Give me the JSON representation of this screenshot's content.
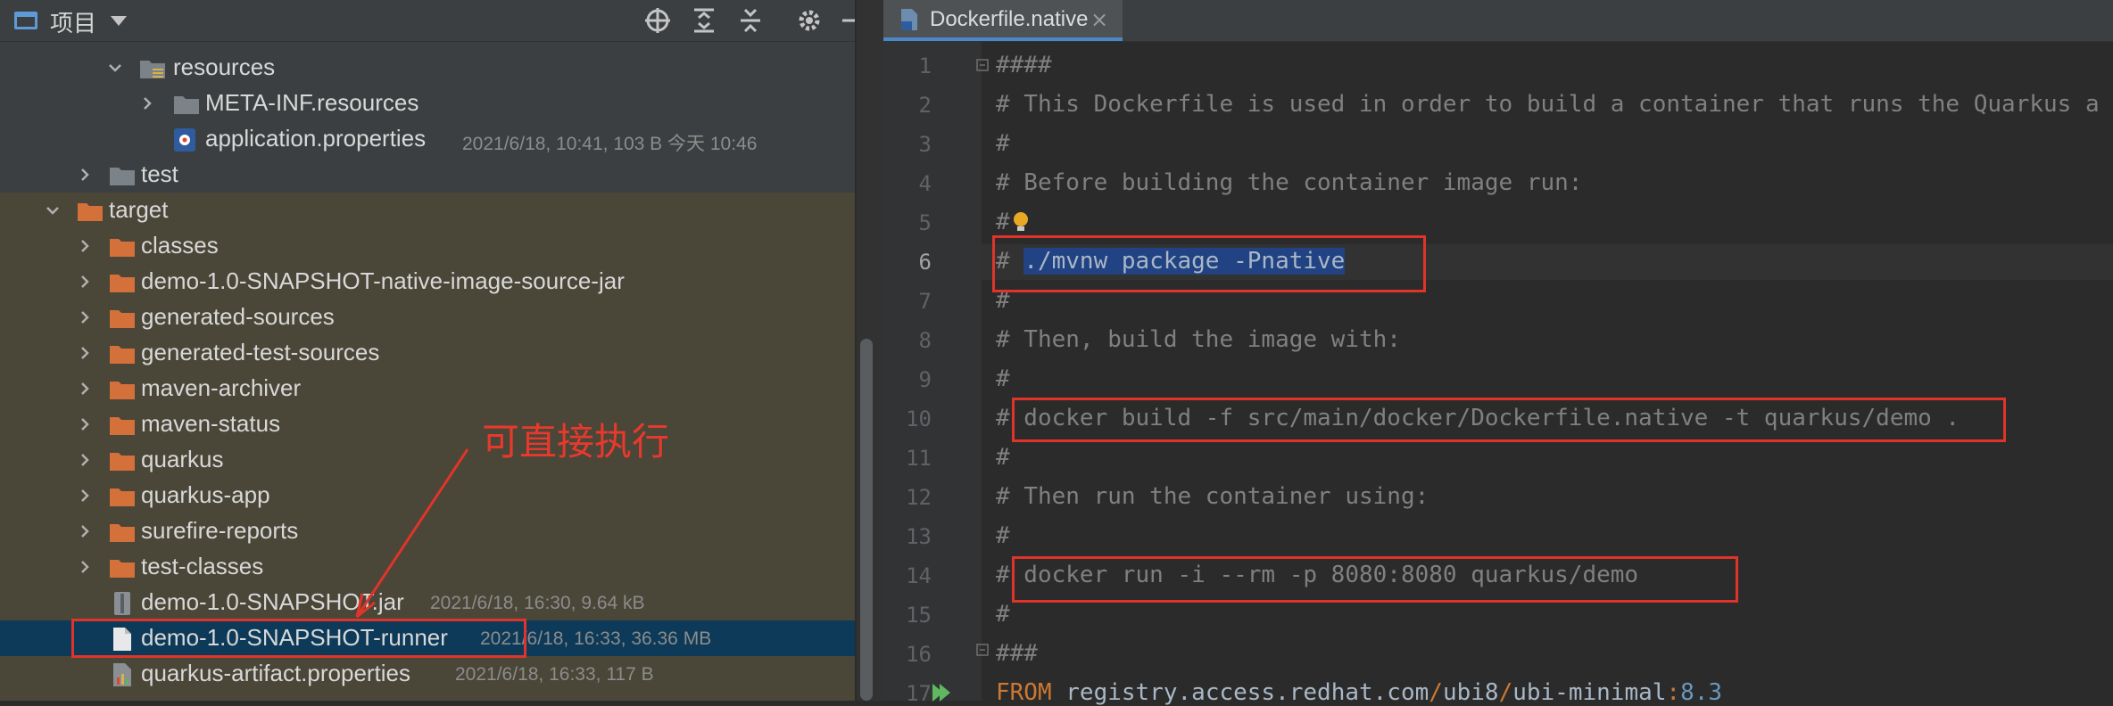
{
  "project_panel": {
    "title": "项目",
    "tree": [
      {
        "label": "resources",
        "meta": ""
      },
      {
        "label": "META-INF.resources",
        "meta": ""
      },
      {
        "label": "application.properties",
        "meta": "2021/6/18, 10:41, 103 B 今天 10:46"
      },
      {
        "label": "test",
        "meta": ""
      },
      {
        "label": "target",
        "meta": ""
      },
      {
        "label": "classes",
        "meta": ""
      },
      {
        "label": "demo-1.0-SNAPSHOT-native-image-source-jar",
        "meta": ""
      },
      {
        "label": "generated-sources",
        "meta": ""
      },
      {
        "label": "generated-test-sources",
        "meta": ""
      },
      {
        "label": "maven-archiver",
        "meta": ""
      },
      {
        "label": "maven-status",
        "meta": ""
      },
      {
        "label": "quarkus",
        "meta": ""
      },
      {
        "label": "quarkus-app",
        "meta": ""
      },
      {
        "label": "surefire-reports",
        "meta": ""
      },
      {
        "label": "test-classes",
        "meta": ""
      },
      {
        "label": "demo-1.0-SNAPSHOT.jar",
        "meta": "2021/6/18, 16:30, 9.64 kB"
      },
      {
        "label": "demo-1.0-SNAPSHOT-runner",
        "meta": "2021/6/18, 16:33, 36.36 MB"
      },
      {
        "label": "quarkus-artifact.properties",
        "meta": "2021/6/18, 16:33, 117 B"
      }
    ]
  },
  "annotation": {
    "note": "可直接执行"
  },
  "editor": {
    "tab_label": "Dockerfile.native",
    "tab_close": "×",
    "line_numbers": [
      "1",
      "2",
      "3",
      "4",
      "5",
      "6",
      "7",
      "8",
      "9",
      "10",
      "11",
      "12",
      "13",
      "14",
      "15",
      "16",
      "17"
    ],
    "lines": {
      "l1": "####",
      "l2": "# This Dockerfile is used in order to build a container that runs the Quarkus a",
      "l3": "#",
      "l4": "# Before building the container image run:",
      "l5": "#",
      "l6_hash": "# ",
      "l6_sel": "./mvnw package -Pnative",
      "l7": "#",
      "l8": "# Then, build the image with:",
      "l9": "#",
      "l10": "# docker build -f src/main/docker/Dockerfile.native -t quarkus/demo .",
      "l11": "#",
      "l12": "# Then run the container using:",
      "l13": "#",
      "l14": "# docker run -i --rm -p 8080:8080 quarkus/demo",
      "l15": "#",
      "l16": "###",
      "l17_kw": "FROM ",
      "l17_a": "registry.access.redhat.com",
      "l17_s1": "/",
      "l17_b": "ubi8",
      "l17_s2": "/",
      "l17_c": "ubi-minimal",
      "l17_s3": ":",
      "l17_v": "8.3"
    }
  },
  "colors": {
    "annotation_red": "#e0342a",
    "selection": "#214283",
    "folder_orange": "#d4703a"
  }
}
